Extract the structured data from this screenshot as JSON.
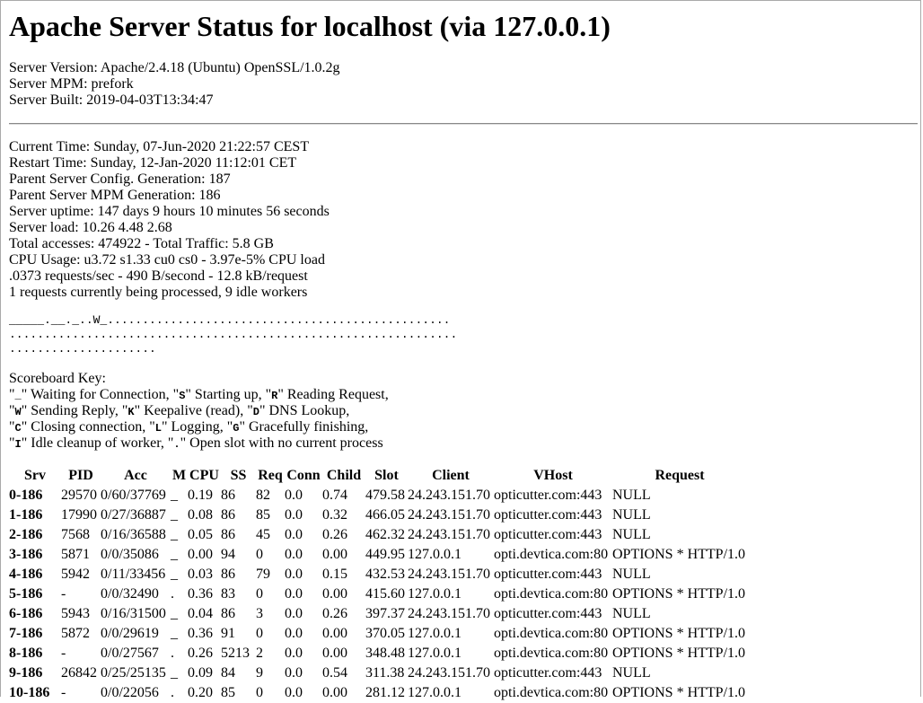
{
  "title": "Apache Server Status for localhost (via 127.0.0.1)",
  "server_info": [
    "Server Version: Apache/2.4.18 (Ubuntu) OpenSSL/1.0.2g",
    "Server MPM: prefork",
    "Server Built: 2019-04-03T13:34:47"
  ],
  "status_lines": [
    "Current Time: Sunday, 07-Jun-2020 21:22:57 CEST",
    "Restart Time: Sunday, 12-Jan-2020 11:12:01 CET",
    "Parent Server Config. Generation: 187",
    "Parent Server MPM Generation: 186",
    "Server uptime: 147 days 9 hours 10 minutes 56 seconds",
    "Server load: 10.26 4.48 2.68",
    "Total accesses: 474922 - Total Traffic: 5.8 GB",
    "CPU Usage: u3.72 s1.33 cu0 cs0 - 3.97e-5% CPU load",
    ".0373 requests/sec - 490 B/second - 12.8 kB/request",
    "1 requests currently being processed, 9 idle workers"
  ],
  "scoreboard": [
    "_____.__._..W_.................................................",
    "................................................................",
    "....................."
  ],
  "scoreboard_key": {
    "heading": "Scoreboard Key:",
    "lines": [
      {
        "parts": [
          {
            "t": "\"",
            "b": false
          },
          {
            "t": "_",
            "b": true
          },
          {
            "t": "\" Waiting for Connection, \"",
            "b": false
          },
          {
            "t": "S",
            "b": true
          },
          {
            "t": "\" Starting up, \"",
            "b": false
          },
          {
            "t": "R",
            "b": true
          },
          {
            "t": "\" Reading Request,",
            "b": false
          }
        ]
      },
      {
        "parts": [
          {
            "t": "\"",
            "b": false
          },
          {
            "t": "W",
            "b": true
          },
          {
            "t": "\" Sending Reply, \"",
            "b": false
          },
          {
            "t": "K",
            "b": true
          },
          {
            "t": "\" Keepalive (read), \"",
            "b": false
          },
          {
            "t": "D",
            "b": true
          },
          {
            "t": "\" DNS Lookup,",
            "b": false
          }
        ]
      },
      {
        "parts": [
          {
            "t": "\"",
            "b": false
          },
          {
            "t": "C",
            "b": true
          },
          {
            "t": "\" Closing connection, \"",
            "b": false
          },
          {
            "t": "L",
            "b": true
          },
          {
            "t": "\" Logging, \"",
            "b": false
          },
          {
            "t": "G",
            "b": true
          },
          {
            "t": "\" Gracefully finishing,",
            "b": false
          }
        ]
      },
      {
        "parts": [
          {
            "t": "\"",
            "b": false
          },
          {
            "t": "I",
            "b": true
          },
          {
            "t": "\" Idle cleanup of worker, \"",
            "b": false
          },
          {
            "t": ".",
            "b": true
          },
          {
            "t": "\" Open slot with no current process",
            "b": false
          }
        ]
      }
    ]
  },
  "table": {
    "columns": [
      "Srv",
      "PID",
      "Acc",
      "M",
      "CPU",
      "SS",
      "Req",
      "Conn",
      "Child",
      "Slot",
      "Client",
      "VHost",
      "Request"
    ],
    "rows": [
      [
        "0-186",
        "29570",
        "0/60/37769",
        "_",
        "0.19",
        "86",
        "82",
        "0.0",
        "0.74",
        "479.58",
        "24.243.151.70",
        "opticutter.com:443",
        "NULL"
      ],
      [
        "1-186",
        "17990",
        "0/27/36887",
        "_",
        "0.08",
        "86",
        "85",
        "0.0",
        "0.32",
        "466.05",
        "24.243.151.70",
        "opticutter.com:443",
        "NULL"
      ],
      [
        "2-186",
        "7568",
        "0/16/36588",
        "_",
        "0.05",
        "86",
        "45",
        "0.0",
        "0.26",
        "462.32",
        "24.243.151.70",
        "opticutter.com:443",
        "NULL"
      ],
      [
        "3-186",
        "5871",
        "0/0/35086",
        "_",
        "0.00",
        "94",
        "0",
        "0.0",
        "0.00",
        "449.95",
        "127.0.0.1",
        "opti.devtica.com:80",
        "OPTIONS * HTTP/1.0"
      ],
      [
        "4-186",
        "5942",
        "0/11/33456",
        "_",
        "0.03",
        "86",
        "79",
        "0.0",
        "0.15",
        "432.53",
        "24.243.151.70",
        "opticutter.com:443",
        "NULL"
      ],
      [
        "5-186",
        "-",
        "0/0/32490",
        ".",
        "0.36",
        "83",
        "0",
        "0.0",
        "0.00",
        "415.60",
        "127.0.0.1",
        "opti.devtica.com:80",
        "OPTIONS * HTTP/1.0"
      ],
      [
        "6-186",
        "5943",
        "0/16/31500",
        "_",
        "0.04",
        "86",
        "3",
        "0.0",
        "0.26",
        "397.37",
        "24.243.151.70",
        "opticutter.com:443",
        "NULL"
      ],
      [
        "7-186",
        "5872",
        "0/0/29619",
        "_",
        "0.36",
        "91",
        "0",
        "0.0",
        "0.00",
        "370.05",
        "127.0.0.1",
        "opti.devtica.com:80",
        "OPTIONS * HTTP/1.0"
      ],
      [
        "8-186",
        "-",
        "0/0/27567",
        ".",
        "0.26",
        "5213",
        "2",
        "0.0",
        "0.00",
        "348.48",
        "127.0.0.1",
        "opti.devtica.com:80",
        "OPTIONS * HTTP/1.0"
      ],
      [
        "9-186",
        "26842",
        "0/25/25135",
        "_",
        "0.09",
        "84",
        "9",
        "0.0",
        "0.54",
        "311.38",
        "24.243.151.70",
        "opticutter.com:443",
        "NULL"
      ],
      [
        "10-186",
        "-",
        "0/0/22056",
        ".",
        "0.20",
        "85",
        "0",
        "0.0",
        "0.00",
        "281.12",
        "127.0.0.1",
        "opti.devtica.com:80",
        "OPTIONS * HTTP/1.0"
      ]
    ]
  }
}
